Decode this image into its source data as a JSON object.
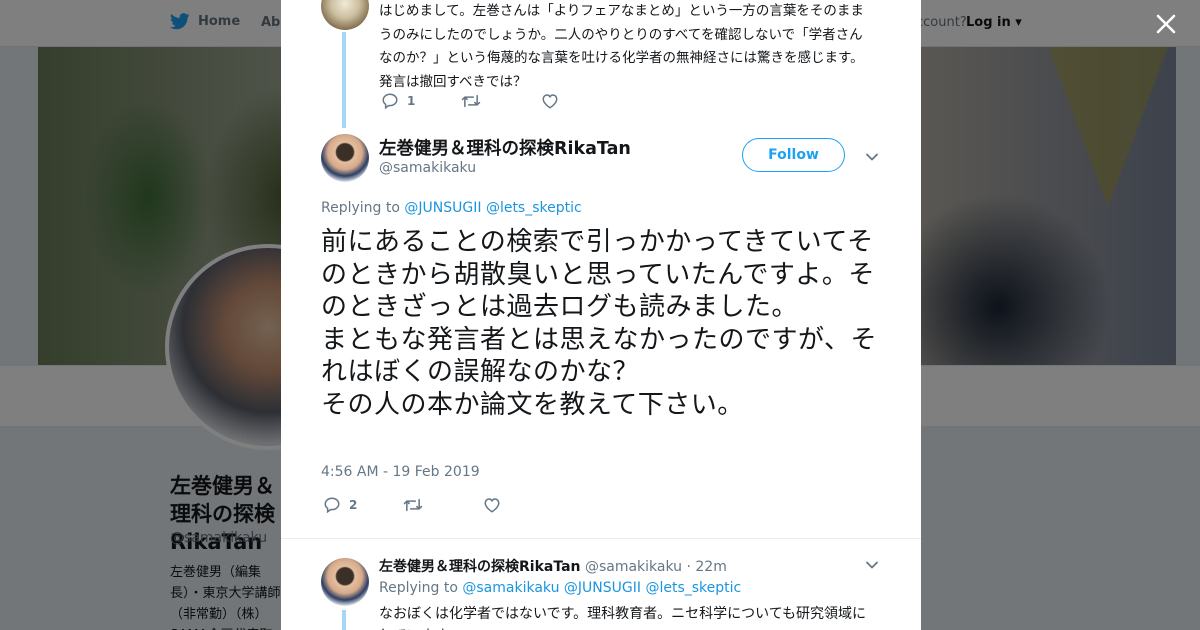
{
  "topnav": {
    "home_label": "Home",
    "about_label": "Abo",
    "account_label": "ccount?",
    "login_label": "Log in"
  },
  "profile": {
    "name": "左巻健男＆理科の探検RikaTan",
    "handle": "@samakikaku",
    "bio": "左巻健男（編集長）・東京大学講師（非常勤）（株）SAMA企画代表取締役。科学検）誌編集長 · R"
  },
  "ancestor_tweet": {
    "text": "はじめまして。左巻さんは「よりフェアなまとめ」という一方の言葉をそのままうのみにしたのでしょうか。二人のやりとりのすべてを確認しないで「学者さんなのか？」という侮蔑的な言葉を吐ける化学者の無神経さには驚きを感じます。発言は撤回すべきでは？",
    "reply_count": "1",
    "retweet_count": "",
    "like_count": ""
  },
  "main_tweet": {
    "name": "左巻健男＆理科の探検RikaTan",
    "handle": "@samakikaku",
    "follow_label": "Follow",
    "replying_prefix": "Replying to",
    "reply_to_1": "@JUNSUGII",
    "reply_to_2": "@lets_skeptic",
    "text": "前にあることの検索で引っかかってきていてそのときから胡散臭いと思っていたんですよ。そのときざっとは過去ログも読みました。\nまともな発言者とは思えなかったのですが、それはぼくの誤解なのかな？\nその人の本か論文を教えて下さい。",
    "timestamp": "4:56 AM - 19 Feb 2019",
    "reply_count": "2",
    "retweet_count": "",
    "like_count": ""
  },
  "reply_tweet": {
    "name": "左巻健男＆理科の探検RikaTan",
    "handle": "@samakikaku",
    "time": "· 22m",
    "replying_prefix": "Replying to",
    "reply_to_1": "@samakikaku",
    "reply_to_2": "@JUNSUGII",
    "reply_to_3": "@lets_skeptic",
    "text": "なおぼくは化学者ではないです。理科教育者。ニセ科学についても研究領域にしています。"
  },
  "colors": {
    "twitter_blue": "#1da1f2",
    "link_blue": "#1b95e0",
    "thread_line": "#a5d7f9",
    "text_secondary": "#657786"
  },
  "icons": [
    "twitter-bird-icon",
    "close-icon",
    "reply-icon",
    "retweet-icon",
    "like-icon",
    "chevron-down-icon"
  ]
}
